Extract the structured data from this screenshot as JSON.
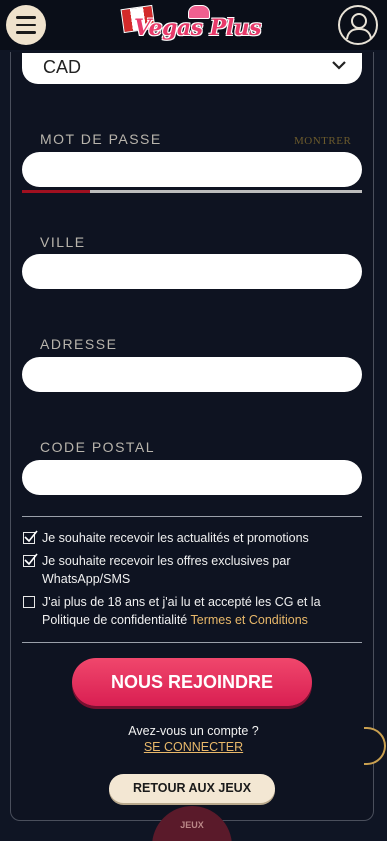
{
  "header": {
    "logo_text": "Vegas Plus"
  },
  "form": {
    "currency_value": "CAD",
    "password_label": "MOT DE PASSE",
    "show_label": "MONTRER",
    "password_strength": 0.2,
    "city_label": "VILLE",
    "address_label": "ADRESSE",
    "postal_label": "CODE POSTAL"
  },
  "consents": [
    {
      "line1": "Je souhaite recevoir les actualités et promotions",
      "checked": true
    },
    {
      "line1": "Je souhaite recevoir les offres exclusives par",
      "line2": "WhatsApp/SMS",
      "checked": true
    },
    {
      "line1": "J'ai plus de 18 ans et j'ai lu et accepté les CG et la",
      "line2": "Politique de confidentialité",
      "terms": "Termes et Conditions",
      "checked": false
    }
  ],
  "actions": {
    "join_label": "NOUS REJOINDRE",
    "have_account": "Avez-vous un compte ?",
    "login_label": "SE CONNECTER",
    "back_label": "RETOUR AUX JEUX",
    "bottom_tab_label": "JEUX"
  },
  "colors": {
    "background": "#0f1524",
    "accent_pink": "#e8305e",
    "link_gold": "#e8b86a"
  }
}
